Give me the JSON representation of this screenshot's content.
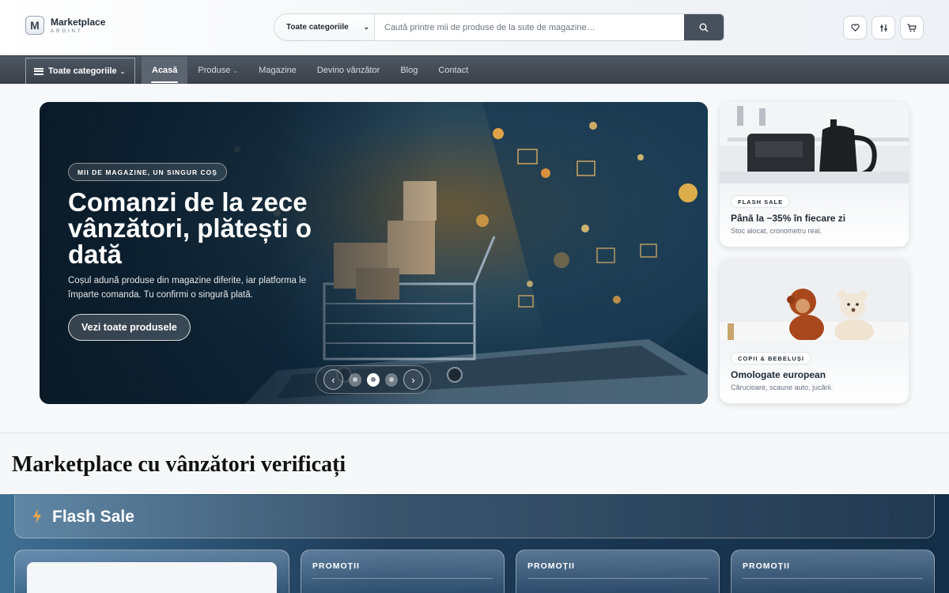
{
  "header": {
    "logo_letter": "M",
    "logo_name": "Marketplace",
    "logo_sub": "ARGINT",
    "search_category": "Toate categoriile",
    "search_placeholder": "Caută printre mii de produse de la sute de magazine…",
    "icons": [
      "heart-icon",
      "compare-icon",
      "cart-icon"
    ]
  },
  "nav": {
    "all_categories": "Toate categoriile",
    "links": [
      "Acasă",
      "Produse",
      "Magazine",
      "Devino vânzător",
      "Blog",
      "Contact"
    ],
    "active_index": 0
  },
  "hero": {
    "badge": "MII DE MAGAZINE, UN SINGUR COȘ",
    "title": "Comanzi de la zece vânzători, plătești o dată",
    "description": "Coșul adună produse din magazine diferite, iar platforma le împarte comanda. Tu confirmi o singură plată.",
    "cta": "Vezi toate produsele",
    "slides_count": 3,
    "active_slide": 1
  },
  "promos": [
    {
      "badge": "FLASH SALE",
      "title": "Până la −35% în fiecare zi",
      "subtitle": "Stoc alocat, cronometru real."
    },
    {
      "badge": "COPII & BEBELUȘI",
      "title": "Omologate european",
      "subtitle": "Cărucioare, scaune auto, jucării."
    }
  ],
  "section_heading": "Marketplace cu vânzători verificați",
  "flash": {
    "title": "Flash Sale",
    "cards": [
      "",
      "PROMOȚII",
      "PROMOȚII",
      "PROMOȚII"
    ]
  },
  "colors": {
    "nav_bg": "#3f4650",
    "search_button": "#47505c",
    "flash_bg": "#1d3b58",
    "flash_icon": "#f0a44a"
  }
}
